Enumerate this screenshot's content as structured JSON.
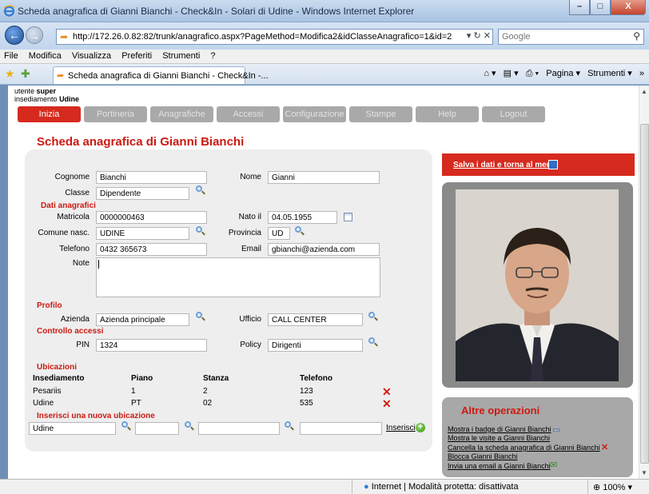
{
  "window": {
    "title": "Scheda anagrafica di Gianni Bianchi - Check&In - Solari di Udine - Windows Internet Explorer",
    "minimize": "–",
    "maximize": "□",
    "close": "X"
  },
  "address": {
    "url": "http://172.26.0.82:82/trunk/anagrafico.aspx?PageMethod=Modifica2&idClasseAnagrafico=1&id=2",
    "actions": "▾ ↻ ✕",
    "search_placeholder": "Google"
  },
  "menu": [
    "File",
    "Modifica",
    "Visualizza",
    "Preferiti",
    "Strumenti",
    "?"
  ],
  "browser_tab": {
    "label": "Scheda anagrafica di Gianni Bianchi - Check&In -..."
  },
  "command_bar": {
    "home": "⌂ ▾",
    "feeds": "▤ ▾",
    "print": "⎙ ▾",
    "page": "Pagina ▾",
    "tools": "Strumenti ▾",
    "more": "»"
  },
  "user": {
    "line1_label": "utente",
    "line1_value": "super",
    "line2_label": "insediamento",
    "line2_value": "Udine"
  },
  "nav_tabs": [
    "Inizia",
    "Portineria",
    "Anagrafiche",
    "Accessi",
    "Configurazione",
    "Stampe",
    "Help",
    "Logout"
  ],
  "page_title": "Scheda anagrafica di Gianni Bianchi",
  "form": {
    "cognome_label": "Cognome",
    "cognome_value": "Bianchi",
    "nome_label": "Nome",
    "nome_value": "Gianni",
    "classe_label": "Classe",
    "classe_value": "Dipendente",
    "section_dati": "Dati anagrafici",
    "matricola_label": "Matricola",
    "matricola_value": "0000000463",
    "nato_label": "Nato il",
    "nato_value": "04.05.1955",
    "comune_label": "Comune nasc.",
    "comune_value": "UDINE",
    "provincia_label": "Provincia",
    "provincia_value": "UD",
    "telefono_label": "Telefono",
    "telefono_value": "0432 365673",
    "email_label": "Email",
    "email_value": "gbianchi@azienda.com",
    "note_label": "Note",
    "section_profilo": "Profilo",
    "azienda_label": "Azienda",
    "azienda_value": "Azienda principale",
    "ufficio_label": "Ufficio",
    "ufficio_value": "CALL CENTER",
    "section_controllo": "Controllo accessi",
    "pin_label": "PIN",
    "pin_value": "1324",
    "policy_label": "Policy",
    "policy_value": "Dirigenti"
  },
  "ubicazioni": {
    "section": "Ubicazioni",
    "headers": [
      "Insediamento",
      "Piano",
      "Stanza",
      "Telefono"
    ],
    "rows": [
      [
        "Pesariis",
        "1",
        "2",
        "123"
      ],
      [
        "Udine",
        "PT",
        "02",
        "535"
      ]
    ],
    "new_section": "Inserisci una nuova ubicazione",
    "new_insediamento": "Udine",
    "insert_label": "Inserisci"
  },
  "save": {
    "label": "Salva i dati e torna al menù"
  },
  "operations": {
    "title": "Altre operazioni",
    "links": [
      "Mostra i badge di Gianni Bianchi",
      "Mostra le visite a Gianni Bianchi",
      "Cancella la scheda anagrafica di Gianni Bianchi",
      "Blocca Gianni Bianchi",
      "Invia una email a Gianni Bianchi"
    ]
  },
  "status": {
    "zone": "Internet | Modalità protetta: disattivata",
    "zoom": "100%"
  },
  "colors": {
    "accent_red": "#d62a1e",
    "title_red": "#cc1a12",
    "nav_grey": "#a9a9a9"
  }
}
